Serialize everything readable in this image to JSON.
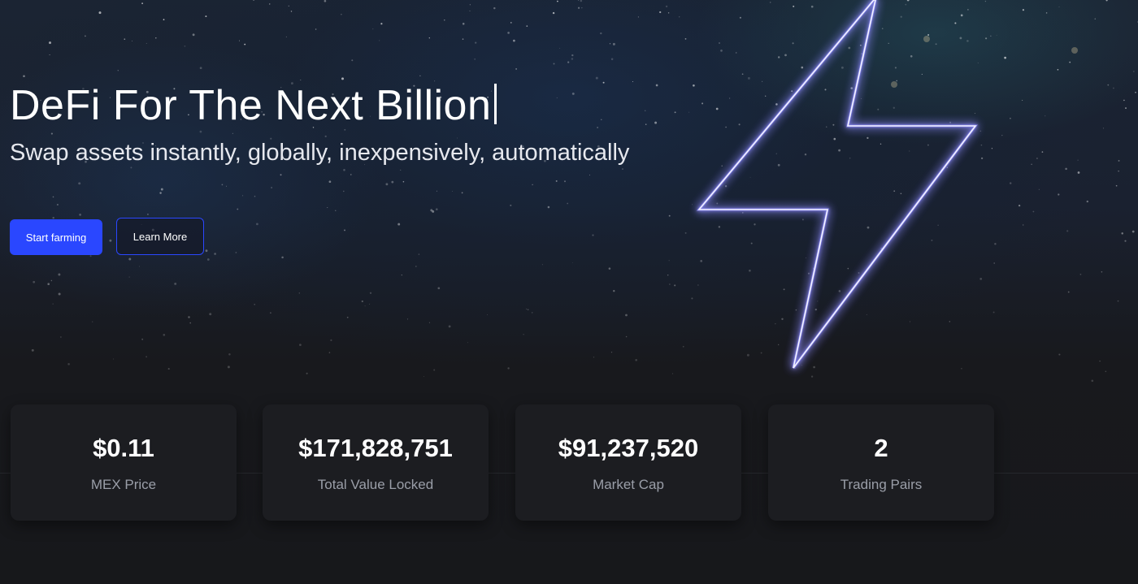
{
  "hero": {
    "title": "DeFi For The Next Billion",
    "subtitle": "Swap assets instantly, globally, inexpensively, automatically"
  },
  "buttons": {
    "primary_label": "Start farming",
    "secondary_label": "Learn More"
  },
  "stats": [
    {
      "value": "$0.11",
      "label": "MEX Price"
    },
    {
      "value": "$171,828,751",
      "label": "Total Value Locked"
    },
    {
      "value": "$91,237,520",
      "label": "Market Cap"
    },
    {
      "value": "2",
      "label": "Trading Pairs"
    }
  ],
  "colors": {
    "accent": "#2a47ff",
    "background": "#17181b",
    "card": "#1c1d21",
    "bolt_glow": "#8f8cff"
  },
  "icons": {
    "hero_graphic": "lightning-bolt-icon"
  }
}
